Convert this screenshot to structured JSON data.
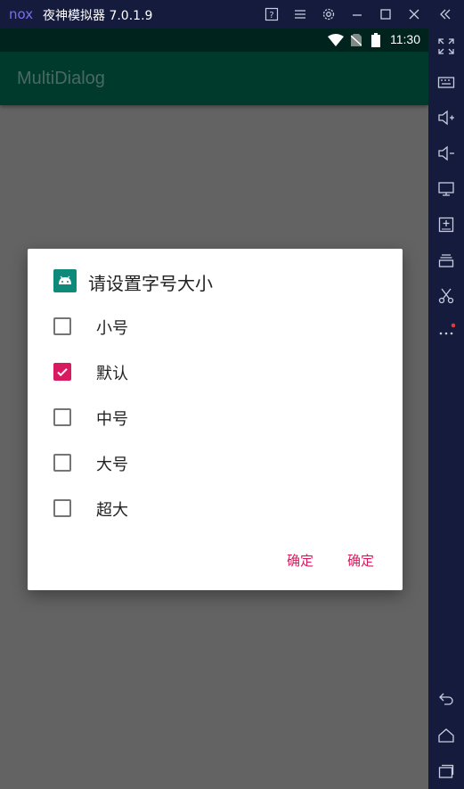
{
  "window": {
    "title": "夜神模拟器 7.0.1.9",
    "logo_text": "nox"
  },
  "statusbar": {
    "time": "11:30"
  },
  "appbar": {
    "title": "MultiDialog"
  },
  "dialog": {
    "title": "请设置字号大小",
    "options": [
      {
        "label": "小号",
        "checked": false
      },
      {
        "label": "默认",
        "checked": true
      },
      {
        "label": "中号",
        "checked": false
      },
      {
        "label": "大号",
        "checked": false
      },
      {
        "label": "超大",
        "checked": false
      }
    ],
    "buttons": [
      {
        "label": "确定"
      },
      {
        "label": "确定"
      }
    ]
  },
  "colors": {
    "accent": "#d81b60",
    "appbar": "#003a2d",
    "statusbar": "#00241d",
    "emulator_chrome": "#151b3d"
  }
}
